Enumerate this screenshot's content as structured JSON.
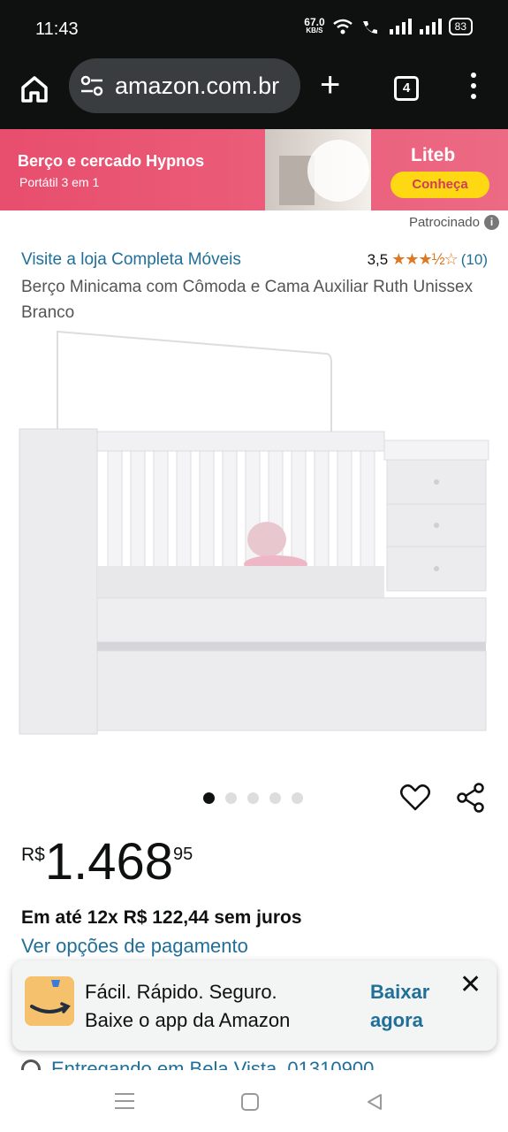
{
  "status_bar": {
    "time": "11:43",
    "net_speed_value": "67.0",
    "net_speed_unit": "KB/S",
    "battery": "83"
  },
  "browser": {
    "url": "amazon.com.br",
    "tab_count": "4"
  },
  "banner": {
    "title": "Berço e cercado Hypnos",
    "subtitle": "Portátil 3 em 1",
    "brand": "Liteb",
    "cta": "Conheça",
    "accent_color": "#e84e6d",
    "cta_color": "#ffd814"
  },
  "sponsored_label": "Patrocinado",
  "product": {
    "store_link": "Visite a loja Completa Móveis",
    "rating_value": "3,5",
    "rating_stars": "★★★½☆",
    "rating_count": "(10)",
    "title": "Berço Minicama com Cômoda e Cama Auxiliar Ruth Unissex Branco",
    "image_count": 5,
    "active_image": 1
  },
  "price": {
    "currency": "R$",
    "whole": "1.468",
    "fraction": "95"
  },
  "installments": "Em até 12x R$ 122,44 sem juros",
  "payment_options_link": "Ver opções de pagamento",
  "app_promo": {
    "line1": "Fácil. Rápido. Seguro.",
    "line2": "Baixe o app da Amazon",
    "cta_line1": "Baixar",
    "cta_line2": "agora",
    "close": "✕"
  },
  "delivery": "Entregando em Bela Vista, 01310900",
  "link_color": "#1f6f99"
}
